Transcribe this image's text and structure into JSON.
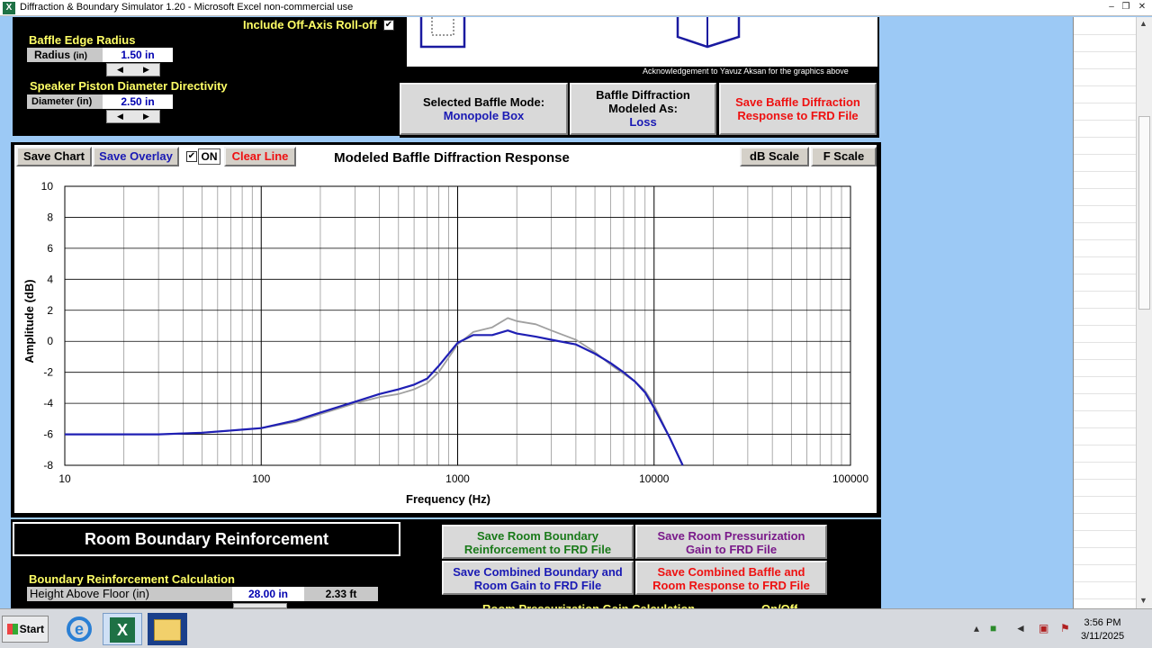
{
  "window": {
    "title": "Diffraction & Boundary Simulator 1.20 - Microsoft Excel non-commercial use",
    "app_icon": "X"
  },
  "top_panel": {
    "offaxis_label": "Include Off-Axis Roll-off",
    "offaxis_checked": "✔",
    "baffle_edge_title": "Baffle Edge Radius",
    "radius_label": "Radius",
    "radius_unit": "(in)",
    "radius_value": "1.50 in",
    "piston_title": "Speaker Piston Diameter Directivity",
    "diameter_label": "Diameter (in)",
    "diameter_value": "2.50 in",
    "spin_left": "◀",
    "spin_right": "▶"
  },
  "graphics": {
    "acknowledgement": "Acknowledgement to Yavuz Aksan for the graphics above"
  },
  "mode": {
    "selected_label": "Selected Baffle Mode:",
    "selected_value": "Monopole Box",
    "modeled_label_1": "Baffle Diffraction",
    "modeled_label_2": "Modeled As:",
    "modeled_value": "Loss",
    "save_label_1": "Save Baffle Diffraction",
    "save_label_2": "Response to FRD File"
  },
  "chart_toolbar": {
    "save_chart": "Save Chart",
    "save_overlay": "Save Overlay",
    "overlay_check": "✔",
    "on_label": "ON",
    "clear_line": "Clear Line",
    "db_scale": "dB Scale",
    "f_scale": "F Scale"
  },
  "chart_data": {
    "type": "line",
    "title": "Modeled Baffle Diffraction Response",
    "xlabel": "Frequency (Hz)",
    "ylabel": "Amplitude (dB)",
    "xscale": "log",
    "xlim": [
      10,
      100000
    ],
    "ylim": [
      -8,
      10
    ],
    "grid": true,
    "x_ticks": [
      "10",
      "100",
      "1000",
      "10000",
      "100000"
    ],
    "y_ticks": [
      "10",
      "8",
      "6",
      "4",
      "2",
      "0",
      "-2",
      "-4",
      "-6",
      "-8"
    ],
    "colors": {
      "overlay": "#a0a0a0",
      "current": "#1f1fb4"
    },
    "series": [
      {
        "x": [
          10,
          20,
          30,
          50,
          80,
          100,
          150,
          200,
          300,
          400,
          500,
          600,
          700,
          800,
          1000,
          1200,
          1500,
          1800,
          2000,
          2500,
          3000,
          4000,
          5000,
          6000,
          7000,
          8000,
          9000,
          10000,
          12000,
          14000
        ],
        "y": [
          -6,
          -6,
          -6,
          -5.9,
          -5.7,
          -5.6,
          -5.2,
          -4.7,
          -4,
          -3.6,
          -3.4,
          -3.1,
          -2.7,
          -2,
          -0.2,
          0.6,
          0.9,
          1.5,
          1.3,
          1.1,
          0.7,
          0.1,
          -0.7,
          -1.5,
          -2.1,
          -2.6,
          -3.2,
          -4.1,
          -6.2,
          -8
        ]
      },
      {
        "x": [
          10,
          20,
          30,
          50,
          80,
          100,
          150,
          200,
          300,
          400,
          500,
          600,
          700,
          800,
          1000,
          1200,
          1500,
          1800,
          2000,
          2500,
          3000,
          4000,
          5000,
          6000,
          7000,
          8000,
          9000,
          10000,
          12000,
          14000
        ],
        "y": [
          -6,
          -6,
          -6,
          -5.9,
          -5.7,
          -5.6,
          -5.1,
          -4.6,
          -3.9,
          -3.4,
          -3.1,
          -2.8,
          -2.4,
          -1.6,
          -0.1,
          0.4,
          0.4,
          0.7,
          0.5,
          0.3,
          0.1,
          -0.2,
          -0.8,
          -1.4,
          -2,
          -2.6,
          -3.3,
          -4.3,
          -6.2,
          -8
        ]
      }
    ]
  },
  "bottom": {
    "rbr_title": "Room Boundary Reinforcement",
    "calc_title": "Boundary Reinforcement Calculation",
    "height_label": "Height Above Floor (in)",
    "height_value": "28.00 in",
    "height_ft": "2.33 ft",
    "save_room_boundary_1": "Save Room Boundary",
    "save_room_boundary_2": "Reinforcement to FRD File",
    "save_room_press_1": "Save Room Pressurization",
    "save_room_press_2": "Gain to FRD File",
    "save_combined_boundary_1": "Save Combined Boundary and",
    "save_combined_boundary_2": "Room Gain to FRD File",
    "save_combined_baffle_1": "Save Combined Baffle and",
    "save_combined_baffle_2": "Room Response  to FRD File",
    "press_calc_label": "Room Pressurization Gain Calculation",
    "onoff_label": "On/Off"
  },
  "taskbar": {
    "start": "Start",
    "time": "3:56 PM",
    "date": "3/11/2025"
  }
}
